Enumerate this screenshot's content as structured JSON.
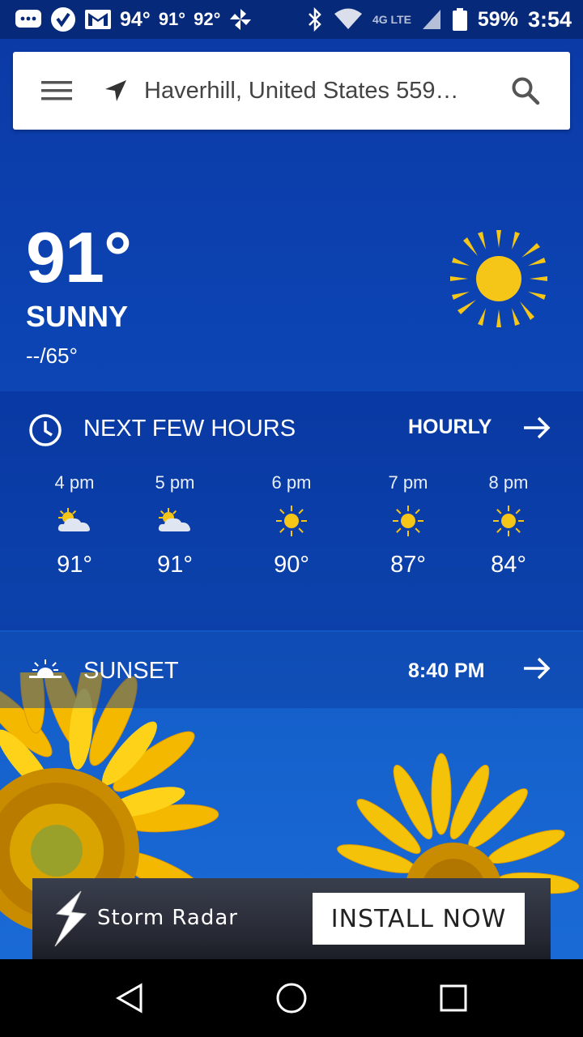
{
  "status_bar": {
    "temps": [
      "94°",
      "91°",
      "92°"
    ],
    "network": "4G LTE",
    "battery": "59%",
    "time": "3:54"
  },
  "search": {
    "location": "Haverhill, United States 559…"
  },
  "current": {
    "temperature": "91°",
    "condition": "SUNNY",
    "hi_lo": "--/65°",
    "icon": "sun-icon"
  },
  "hours": {
    "title": "NEXT FEW HOURS",
    "link_label": "HOURLY",
    "items": [
      {
        "time": "4 pm",
        "icon": "partly-cloudy-icon",
        "temp": "91°"
      },
      {
        "time": "5 pm",
        "icon": "partly-cloudy-icon",
        "temp": "91°"
      },
      {
        "time": "6 pm",
        "icon": "sun-icon",
        "temp": "90°"
      },
      {
        "time": "7 pm",
        "icon": "sun-icon",
        "temp": "87°"
      },
      {
        "time": "8 pm",
        "icon": "sun-icon",
        "temp": "84°"
      }
    ]
  },
  "sunset": {
    "label": "SUNSET",
    "time": "8:40 PM"
  },
  "ad": {
    "title": "Storm Radar",
    "button": "INSTALL NOW"
  },
  "colors": {
    "background": "#0b3aa6",
    "sun": "#f5c518",
    "status_bar": "#07297a"
  }
}
